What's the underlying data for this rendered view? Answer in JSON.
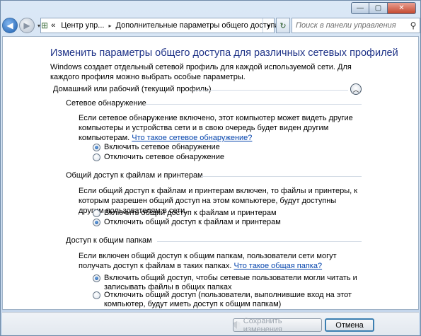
{
  "window": {
    "minimize_glyph": "—",
    "maximize_glyph": "▢",
    "close_glyph": "✕"
  },
  "nav": {
    "back_glyph": "◀",
    "forward_glyph": "▶",
    "history_glyph": "▾"
  },
  "address": {
    "overflow": "«",
    "segments": [
      "Центр упр...",
      "Дополнительные параметры общего доступа"
    ],
    "separator_glyph": "▸",
    "dropdown_glyph": "▾"
  },
  "refresh_glyph": "↻",
  "search": {
    "placeholder": "Поиск в панели управления",
    "icon": "search-icon"
  },
  "page": {
    "title": "Изменить параметры общего доступа для различных сетевых профилей",
    "intro": "Windows создает отдельный сетевой профиль для каждой используемой сети. Для каждого профиля можно выбрать особые параметры.",
    "group_header": "Домашний или рабочий (текущий профиль)",
    "collapse_glyph": "︿"
  },
  "sections": {
    "discovery": {
      "title": "Сетевое обнаружение",
      "desc": "Если сетевое обнаружение включено, этот компьютер может видеть другие компьютеры и устройства сети и в свою очередь будет виден другим компьютерам.",
      "link": "Что такое сетевое обнаружение?",
      "options": [
        {
          "label": "Включить сетевое обнаружение",
          "checked": true
        },
        {
          "label": "Отключить сетевое обнаружение",
          "checked": false
        }
      ]
    },
    "file_sharing": {
      "title": "Общий доступ к файлам и принтерам",
      "desc": "Если общий доступ к файлам и принтерам включен, то файлы и принтеры, к которым разрешен общий доступ на этом компьютере, будут доступны другим пользователям в сети.",
      "options": [
        {
          "label": "Включить общий доступ к файлам и принтерам",
          "checked": false
        },
        {
          "label": "Отключить общий доступ к файлам и принтерам",
          "checked": true
        }
      ]
    },
    "public_folders": {
      "title": "Доступ к общим папкам",
      "desc": "Если включен общий доступ к общим папкам, пользователи сети могут получать доступ к файлам в таких папках.",
      "link": "Что такое общая папка?",
      "options": [
        {
          "label": "Включить общий доступ, чтобы сетевые пользователи могли читать и записывать файлы в общих папках",
          "checked": true
        },
        {
          "label": "Отключить общий доступ (пользователи, выполнившие вход на этот компьютер, будут иметь доступ к общим папкам)",
          "checked": false
        }
      ]
    }
  },
  "footer": {
    "save_label": "Сохранить изменения",
    "save_enabled": false,
    "cancel_label": "Отмена"
  }
}
